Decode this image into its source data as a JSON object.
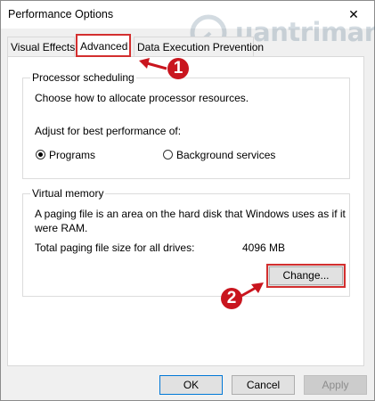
{
  "window": {
    "title": "Performance Options",
    "close_glyph": "✕"
  },
  "watermark": {
    "text": "uantrimang"
  },
  "tabs": [
    {
      "label": "Visual Effects",
      "selected": false
    },
    {
      "label": "Advanced",
      "selected": true
    },
    {
      "label": "Data Execution Prevention",
      "selected": false
    }
  ],
  "processor": {
    "legend": "Processor scheduling",
    "description": "Choose how to allocate processor resources.",
    "adjust_label": "Adjust for best performance of:",
    "options": [
      {
        "label": "Programs",
        "checked": true
      },
      {
        "label": "Background services",
        "checked": false
      }
    ]
  },
  "virtual_memory": {
    "legend": "Virtual memory",
    "description_line1": "A paging file is an area on the hard disk that Windows uses as if it",
    "description_line2": "were RAM.",
    "total_label": "Total paging file size for all drives:",
    "total_value": "4096 MB",
    "change_label": "Change..."
  },
  "annotations": [
    {
      "number": "1",
      "color": "#c9151e"
    },
    {
      "number": "2",
      "color": "#c9151e"
    }
  ],
  "buttons": {
    "ok": "OK",
    "cancel": "Cancel",
    "apply": "Apply"
  },
  "colors": {
    "highlight": "#d32f2f",
    "focus": "#0078d7"
  },
  "icons": [
    "close-icon",
    "radio-checked-icon",
    "radio-unchecked-icon",
    "arrow-icon",
    "watermark-logo-icon"
  ]
}
